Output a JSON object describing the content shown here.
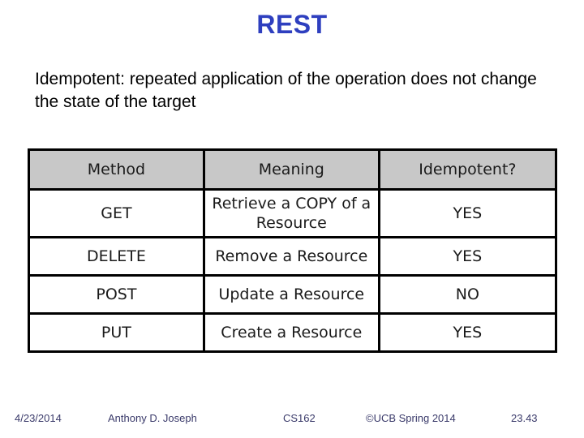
{
  "slide": {
    "title": "REST",
    "bullet": "Idempotent: repeated application of the operation does not change the state of the target",
    "title_color": "#2e3fbf"
  },
  "table": {
    "headers": [
      "Method",
      "Meaning",
      "Idempotent?"
    ],
    "header_bg": "#c8c8c8",
    "rows": [
      {
        "method": "GET",
        "meaning": "Retrieve a COPY of a Resource",
        "idempotent": "YES"
      },
      {
        "method": "DELETE",
        "meaning": "Remove a Resource",
        "idempotent": "YES"
      },
      {
        "method": "POST",
        "meaning": "Update a Resource",
        "idempotent": "NO"
      },
      {
        "method": "PUT",
        "meaning": "Create a Resource",
        "idempotent": "YES"
      }
    ]
  },
  "footer": {
    "date": "4/23/2014",
    "author": "Anthony D. Joseph",
    "course": "CS162",
    "copyright": "©UCB Spring 2014",
    "slide_number": "23.43"
  }
}
